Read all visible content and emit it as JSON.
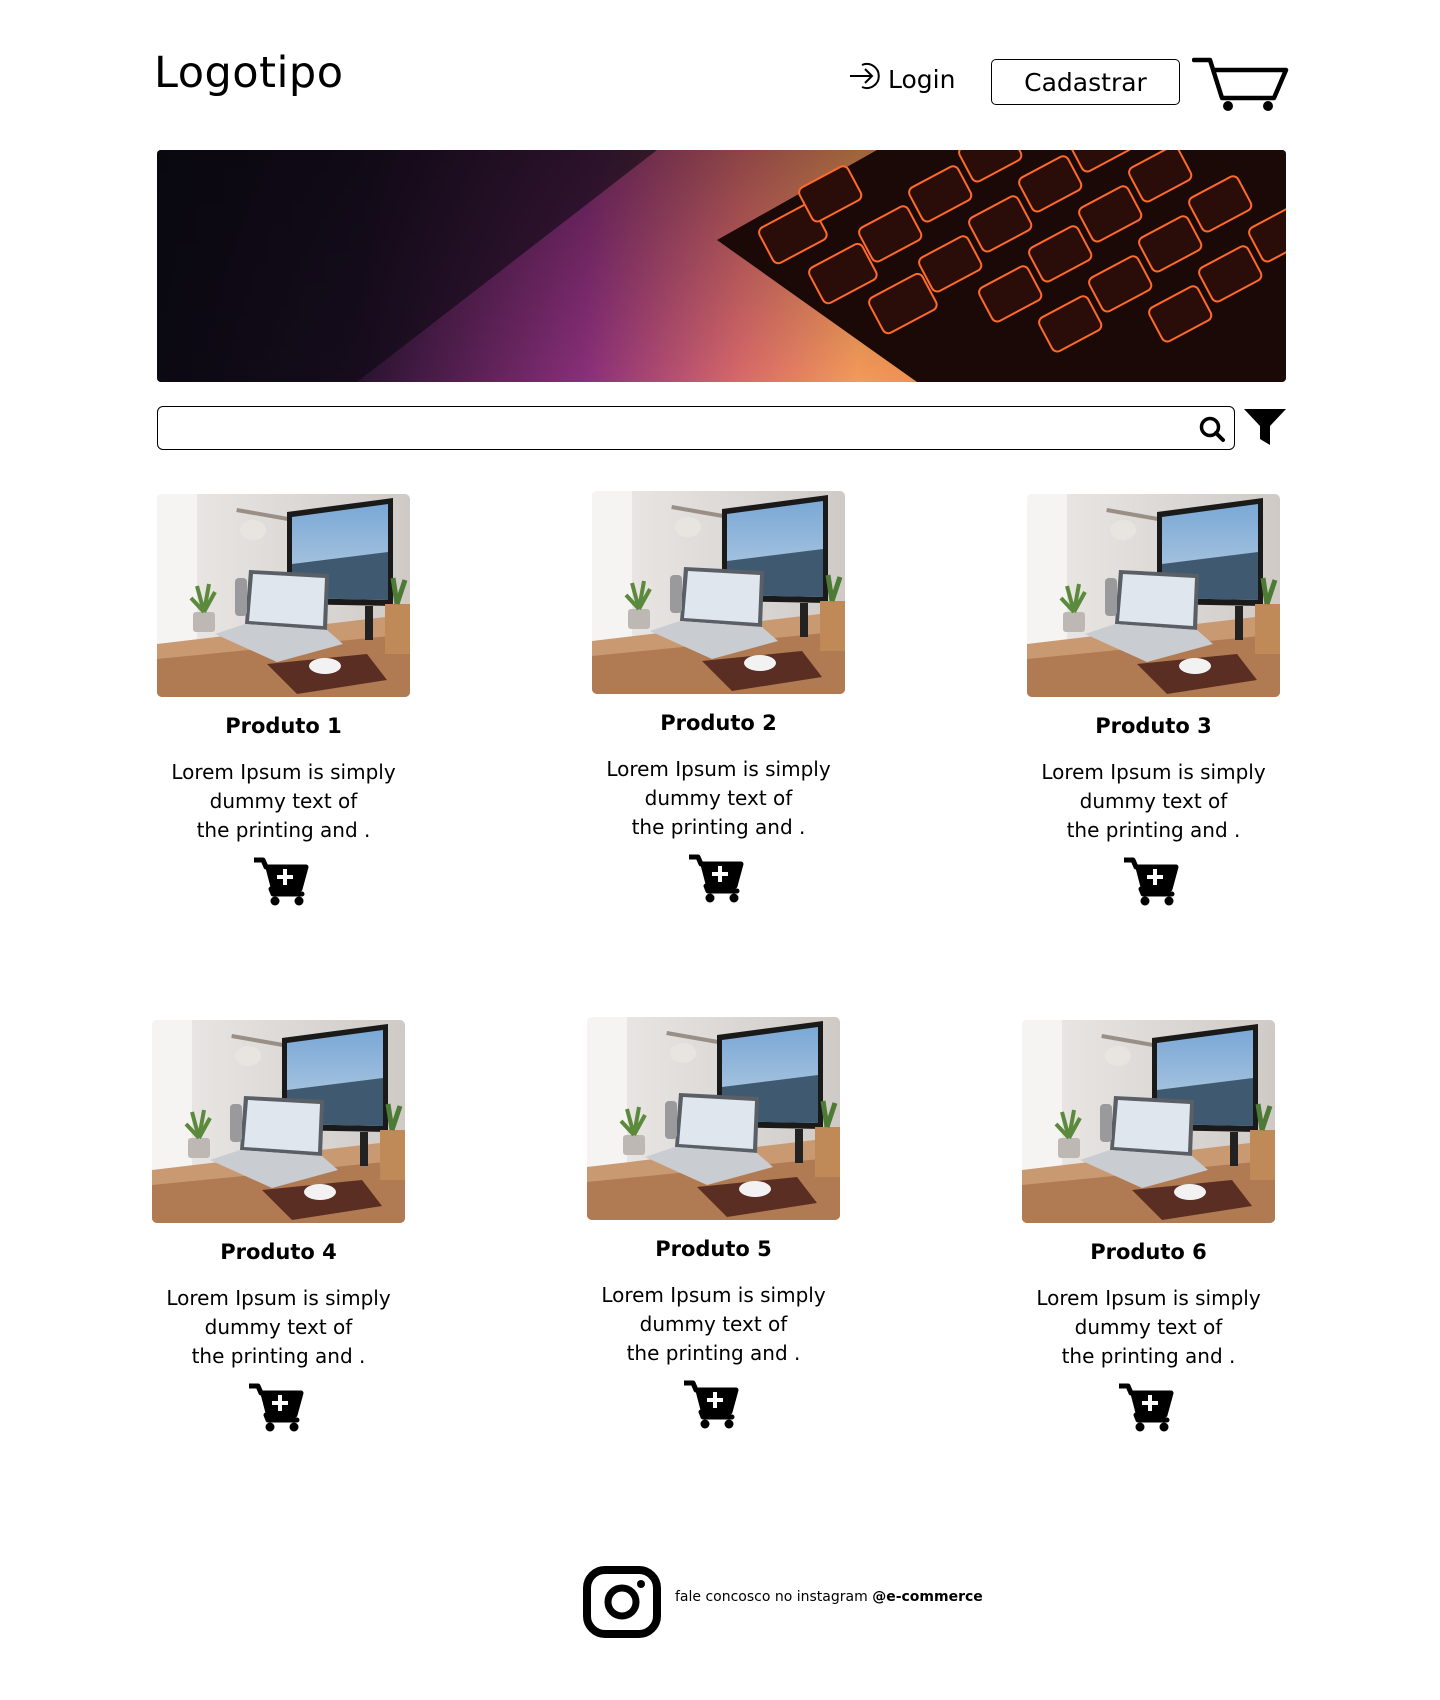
{
  "header": {
    "logo": "Logotipo",
    "login_label": "Login",
    "signup_label": "Cadastrar"
  },
  "icons": {
    "login": "login-arrow-icon",
    "cart": "shopping-cart-icon",
    "search": "search-icon",
    "filter": "filter-icon",
    "add_to_cart": "cart-plus-icon",
    "instagram": "instagram-icon"
  },
  "search": {
    "value": "",
    "placeholder": ""
  },
  "products": [
    {
      "name": "Produto 1",
      "desc": [
        "Lorem Ipsum is simply",
        "dummy text of",
        "the printing and ."
      ]
    },
    {
      "name": "Produto 2",
      "desc": [
        "Lorem Ipsum is simply",
        "dummy text of",
        "the printing and ."
      ]
    },
    {
      "name": "Produto 3",
      "desc": [
        "Lorem Ipsum is simply",
        "dummy text of",
        "the printing and ."
      ]
    },
    {
      "name": "Produto 4",
      "desc": [
        "Lorem Ipsum is simply",
        "dummy text of",
        "the printing and ."
      ]
    },
    {
      "name": "Produto 5",
      "desc": [
        "Lorem Ipsum is simply",
        "dummy text of",
        "the printing and ."
      ]
    },
    {
      "name": "Produto 6",
      "desc": [
        "Lorem Ipsum is simply",
        "dummy text of",
        "the printing and ."
      ]
    }
  ],
  "footer": {
    "text": "fale concosco no instagram",
    "handle": "@e-commerce"
  }
}
